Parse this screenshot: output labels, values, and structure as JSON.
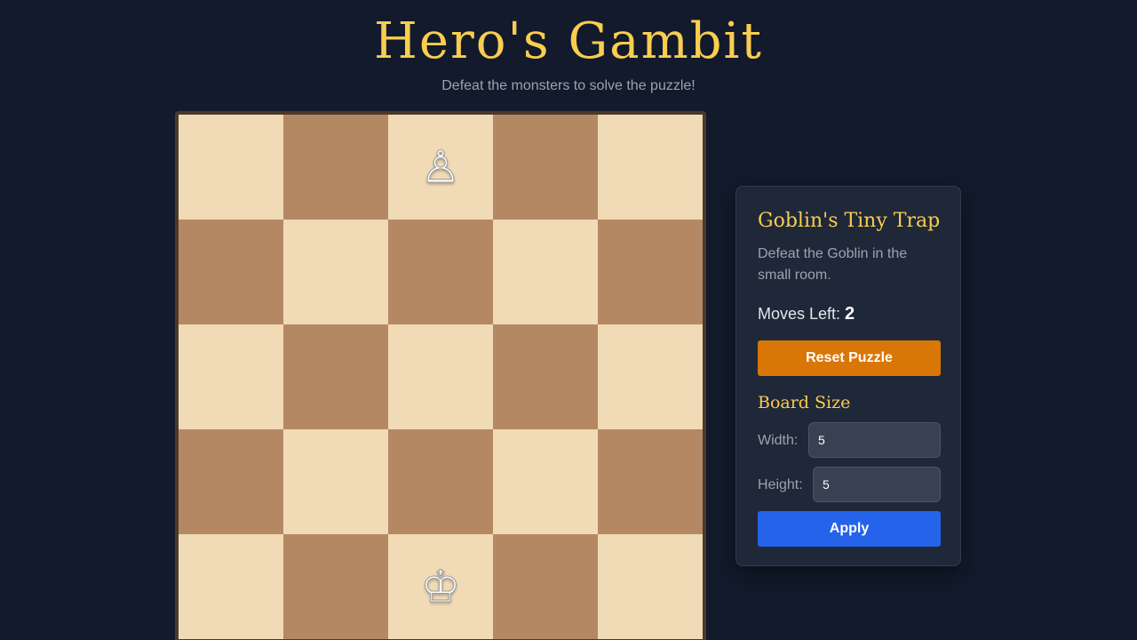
{
  "header": {
    "title": "Hero's Gambit",
    "subtitle": "Defeat the monsters to solve the puzzle!"
  },
  "board": {
    "columns": 5,
    "rows": 5,
    "light_color": "#f0dbb6",
    "dark_color": "#b58864",
    "pieces": [
      {
        "row": 0,
        "col": 2,
        "glyph": "♙",
        "name": "pawn-icon"
      },
      {
        "row": 4,
        "col": 2,
        "glyph": "♔",
        "name": "king-icon"
      }
    ]
  },
  "panel": {
    "puzzle_title": "Goblin's Tiny Trap",
    "puzzle_description": "Defeat the Goblin in the small room.",
    "moves_label": "Moves Left: ",
    "moves_value": "2",
    "reset_label": "Reset Puzzle",
    "board_size_title": "Board Size",
    "width_label": "Width:",
    "width_value": "5",
    "height_label": "Height:",
    "height_value": "5",
    "apply_label": "Apply"
  },
  "colors": {
    "background": "#121a2b",
    "accent_gold": "#f9cd4f",
    "reset_button": "#d97706",
    "apply_button": "#2563eb"
  }
}
